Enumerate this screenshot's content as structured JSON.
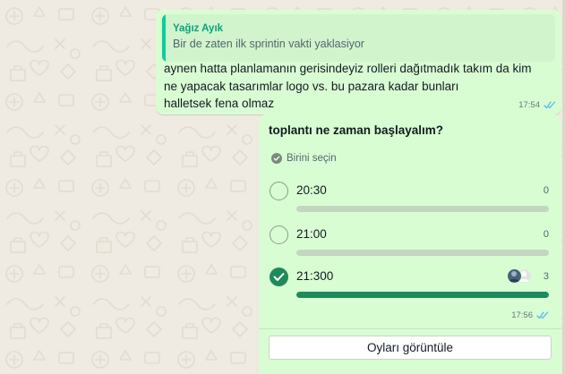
{
  "theme": {
    "chat_background": "#efeae2",
    "bubble_out": "#d9fdd3",
    "quote_accent": "#06cf9c",
    "vote_green": "#1e8a5a",
    "read_ticks": "#53bdeb"
  },
  "message": {
    "quote": {
      "author": "Yağız Ayık",
      "text": "Bir de zaten ilk sprintin vakti yaklasiyor"
    },
    "lines": [
      "aynen hatta planlamanın gerisindeyiz rolleri dağıtmadık takım da kim",
      "ne yapacak tasarımlar logo vs. bu pazara kadar bunları",
      "halletsek fena olmaz"
    ],
    "time": "17:54",
    "status_icon": "double-check-read-icon"
  },
  "poll": {
    "question": "toplantı ne zaman başlayalım?",
    "select_hint": "Birini seçin",
    "options": [
      {
        "label": "20:30",
        "count": "0",
        "selected": false,
        "vote_share": 0
      },
      {
        "label": "21:00",
        "count": "0",
        "selected": false,
        "vote_share": 0
      },
      {
        "label": "21:300",
        "count": "3",
        "selected": true,
        "vote_share": 1
      }
    ],
    "time": "17:56",
    "status_icon": "double-check-read-icon",
    "view_votes_label": "Oyları görüntüle"
  }
}
